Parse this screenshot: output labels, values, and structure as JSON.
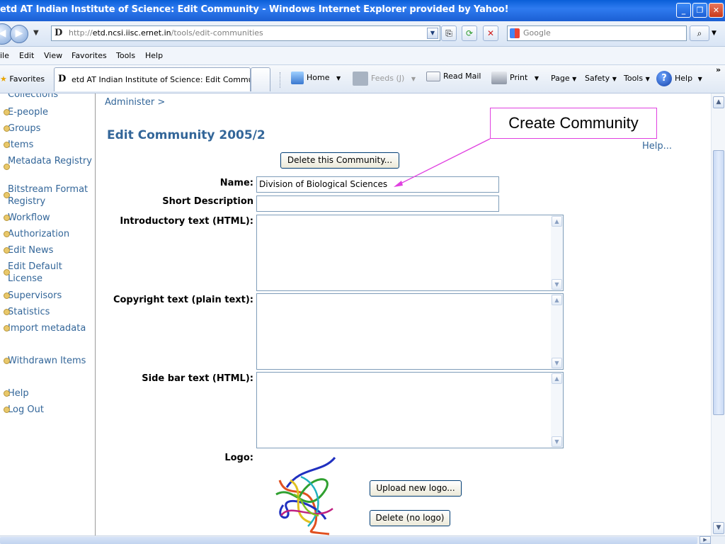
{
  "window": {
    "title": "etd AT Indian Institute of Science: Edit Community - Windows Internet Explorer provided by Yahoo!",
    "minimize": "_",
    "restore": "❐",
    "close": "✕"
  },
  "address_bar": {
    "favicon": "D",
    "url_protocol": "http://",
    "url_host": "etd.ncsi.iisc.ernet.in",
    "url_path": "/tools/edit-communities",
    "search_placeholder": "Google"
  },
  "menu": [
    "ile",
    "Edit",
    "View",
    "Favorites",
    "Tools",
    "Help"
  ],
  "favorites_bar": {
    "favorites_label": "Favorites",
    "tab_favicon": "D",
    "tab_title": "etd AT Indian Institute of Science: Edit Commu...",
    "commands": {
      "home": "Home",
      "feeds": "Feeds (J)",
      "read_mail": "Read Mail",
      "print": "Print",
      "page": "Page",
      "safety": "Safety",
      "tools": "Tools",
      "help": "Help",
      "more": "»"
    }
  },
  "sidebar": {
    "items": [
      "Collections",
      "E-people",
      "Groups",
      "Items",
      "Metadata Registry",
      "Bitstream Format Registry",
      "Workflow",
      "Authorization",
      "Edit News",
      "Edit Default License",
      "Supervisors",
      "Statistics",
      "Import metadata",
      "Withdrawn Items",
      "Help",
      "Log Out"
    ]
  },
  "main": {
    "breadcrumb": "Administer >",
    "page_title": "Edit Community 2005/2",
    "help_link": "Help...",
    "delete_button": "Delete this Community...",
    "fields": {
      "name_label": "Name:",
      "name_value": "Division of Biological Sciences",
      "short_description_label": "Short Description",
      "short_description_value": "",
      "intro_label": "Introductory text (HTML):",
      "copyright_label": "Copyright text (plain text):",
      "sidebar_label": "Side bar text (HTML):",
      "logo_label": "Logo:"
    },
    "upload_logo_button": "Upload new logo...",
    "delete_logo_button": "Delete (no logo)"
  },
  "annotation": {
    "callout_text": "Create Community",
    "color": "#e040e0"
  },
  "colors": {
    "link": "#336699",
    "titlebar": "#1b5fd3"
  }
}
